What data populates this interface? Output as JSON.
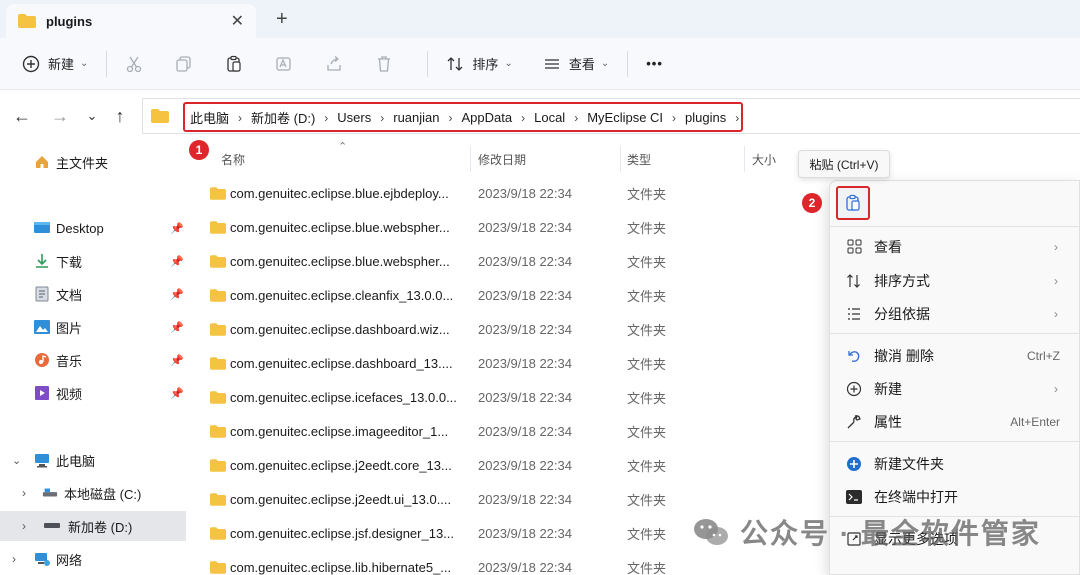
{
  "tab": {
    "title": "plugins"
  },
  "toolbar": {
    "new_label": "新建",
    "sort_label": "排序",
    "view_label": "查看",
    "more_label": "•••"
  },
  "breadcrumbs": [
    "此电脑",
    "新加卷 (D:)",
    "Users",
    "ruanjian",
    "AppData",
    "Local",
    "MyEclipse CI",
    "plugins"
  ],
  "sidebar": {
    "home": "主文件夹",
    "quick": [
      {
        "label": "Desktop",
        "icon": "desktop-icon"
      },
      {
        "label": "下载",
        "icon": "download-icon"
      },
      {
        "label": "文档",
        "icon": "document-icon"
      },
      {
        "label": "图片",
        "icon": "picture-icon"
      },
      {
        "label": "音乐",
        "icon": "music-icon"
      },
      {
        "label": "视频",
        "icon": "video-icon"
      }
    ],
    "thispc": "此电脑",
    "drives": [
      "本地磁盘 (C:)",
      "新加卷 (D:)"
    ],
    "network": "网络"
  },
  "columns": {
    "name": "名称",
    "modified": "修改日期",
    "type": "类型",
    "size": "大小"
  },
  "files": [
    {
      "name": "com.genuitec.eclipse.blue.ejbdeploy...",
      "date": "2023/9/18 22:34",
      "type": "文件夹"
    },
    {
      "name": "com.genuitec.eclipse.blue.webspher...",
      "date": "2023/9/18 22:34",
      "type": "文件夹"
    },
    {
      "name": "com.genuitec.eclipse.blue.webspher...",
      "date": "2023/9/18 22:34",
      "type": "文件夹"
    },
    {
      "name": "com.genuitec.eclipse.cleanfix_13.0.0...",
      "date": "2023/9/18 22:34",
      "type": "文件夹"
    },
    {
      "name": "com.genuitec.eclipse.dashboard.wiz...",
      "date": "2023/9/18 22:34",
      "type": "文件夹"
    },
    {
      "name": "com.genuitec.eclipse.dashboard_13....",
      "date": "2023/9/18 22:34",
      "type": "文件夹"
    },
    {
      "name": "com.genuitec.eclipse.icefaces_13.0.0...",
      "date": "2023/9/18 22:34",
      "type": "文件夹"
    },
    {
      "name": "com.genuitec.eclipse.imageeditor_1...",
      "date": "2023/9/18 22:34",
      "type": "文件夹"
    },
    {
      "name": "com.genuitec.eclipse.j2eedt.core_13...",
      "date": "2023/9/18 22:34",
      "type": "文件夹"
    },
    {
      "name": "com.genuitec.eclipse.j2eedt.ui_13.0....",
      "date": "2023/9/18 22:34",
      "type": "文件夹"
    },
    {
      "name": "com.genuitec.eclipse.jsf.designer_13...",
      "date": "2023/9/18 22:34",
      "type": "文件夹"
    },
    {
      "name": "com.genuitec.eclipse.lib.hibernate5_...",
      "date": "2023/9/18 22:34",
      "type": "文件夹"
    }
  ],
  "badges": {
    "one": "1",
    "two": "2"
  },
  "tooltip": "粘贴 (Ctrl+V)",
  "context_menu": [
    {
      "label": "查看",
      "icon": "grid-icon",
      "submenu": true
    },
    {
      "label": "排序方式",
      "icon": "sort-icon",
      "submenu": true
    },
    {
      "label": "分组依据",
      "icon": "group-icon",
      "submenu": true
    },
    {
      "label": "撤消 删除",
      "icon": "undo-icon",
      "shortcut": "Ctrl+Z"
    },
    {
      "label": "新建",
      "icon": "plus-circle-icon",
      "submenu": true
    },
    {
      "label": "属性",
      "icon": "wrench-icon",
      "shortcut": "Alt+Enter"
    },
    {
      "label": "新建文件夹",
      "icon": "new-folder-icon"
    },
    {
      "label": "在终端中打开",
      "icon": "terminal-icon"
    },
    {
      "label": "显示更多选项",
      "icon": "more-options-icon"
    }
  ],
  "watermark": "公众号 · 最全软件管家",
  "colors": {
    "accent_red": "#d9262c",
    "folder_yellow": "#f5c242",
    "selected_bg": "#e4e6ea"
  }
}
